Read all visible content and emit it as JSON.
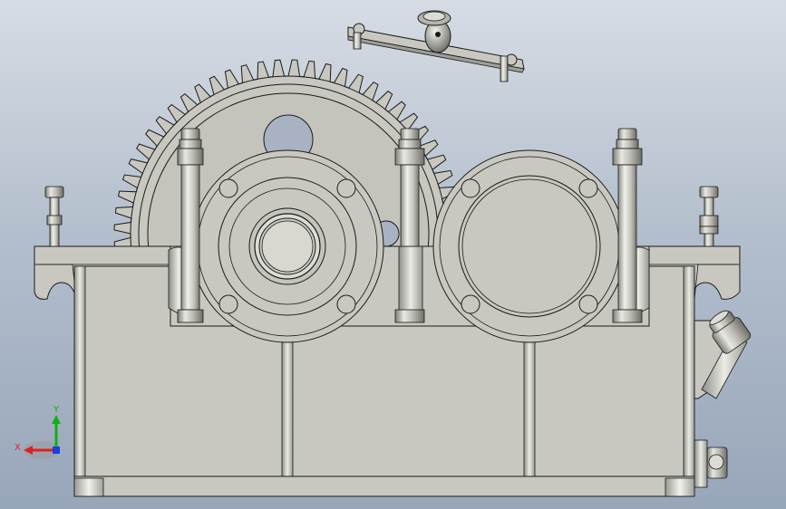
{
  "viewport": {
    "background_top": "#d6dce4",
    "background_bottom": "#98a6ba"
  },
  "model": {
    "part_color": "#c8c8c0",
    "edge_color": "#1a1a1a",
    "shadow_color": "#9e9e98",
    "highlight_color": "#ecece6"
  },
  "triad": {
    "x_label": "X",
    "y_label": "Y",
    "x_color": "#e02020",
    "y_color": "#10b010",
    "z_color": "#1a40e0"
  }
}
